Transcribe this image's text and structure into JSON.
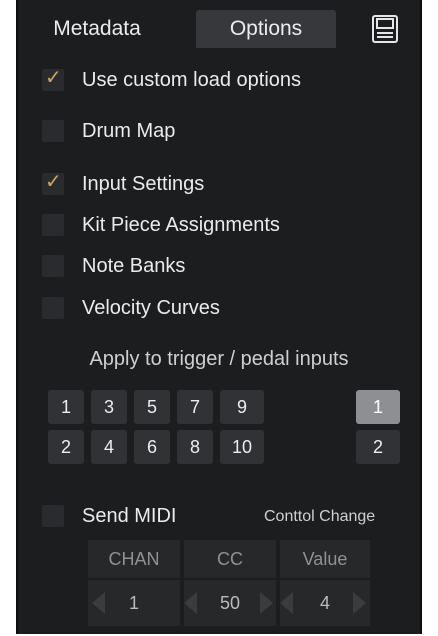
{
  "tabs": [
    {
      "label": "Metadata",
      "active": false
    },
    {
      "label": "Options",
      "active": true
    }
  ],
  "save_icon": "floppy-disk-icon",
  "options": [
    {
      "label": "Use custom load options",
      "checked": true
    },
    {
      "label": "Drum Map",
      "checked": false
    },
    {
      "label": "Input Settings",
      "checked": true
    },
    {
      "label": "Kit Piece Assignments",
      "checked": false
    },
    {
      "label": "Note Banks",
      "checked": false
    },
    {
      "label": "Velocity Curves",
      "checked": false
    }
  ],
  "apply_label": "Apply to trigger / pedal inputs",
  "trigger_inputs": [
    "1",
    "3",
    "5",
    "7",
    "9",
    "2",
    "4",
    "6",
    "8",
    "10"
  ],
  "pedal_inputs": [
    {
      "label": "1",
      "selected": true
    },
    {
      "label": "2",
      "selected": false
    }
  ],
  "send_midi": {
    "label": "Send MIDI",
    "checked": false,
    "type": "Conttol Change",
    "params": [
      {
        "header": "CHAN",
        "value": "1"
      },
      {
        "header": "CC",
        "value": "50"
      },
      {
        "header": "Value",
        "value": "4"
      }
    ]
  },
  "colors": {
    "panel_bg": "#1c1d1f",
    "checkmark": "#d4a35a",
    "button_bg": "#303236",
    "button_selected": "#8d8f93"
  }
}
